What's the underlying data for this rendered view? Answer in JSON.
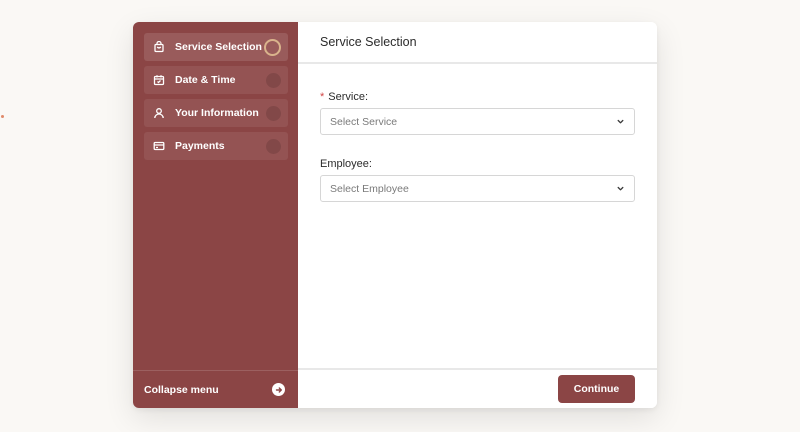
{
  "sidebar": {
    "steps": [
      {
        "label": "Service Selection",
        "icon": "shopping-bag-icon",
        "active": true
      },
      {
        "label": "Date & Time",
        "icon": "calendar-icon",
        "active": false
      },
      {
        "label": "Your Information",
        "icon": "user-icon",
        "active": false
      },
      {
        "label": "Payments",
        "icon": "credit-card-icon",
        "active": false
      }
    ],
    "collapse_label": "Collapse menu"
  },
  "main": {
    "title": "Service Selection",
    "service": {
      "required_mark": "*",
      "label": "Service:",
      "placeholder": "Select Service"
    },
    "employee": {
      "label": "Employee:",
      "placeholder": "Select Employee"
    },
    "continue_label": "Continue"
  },
  "colors": {
    "brand": "#8b4545",
    "active_ring": "#d9b38c",
    "required": "#d24545",
    "page_bg": "#faf8f5"
  }
}
